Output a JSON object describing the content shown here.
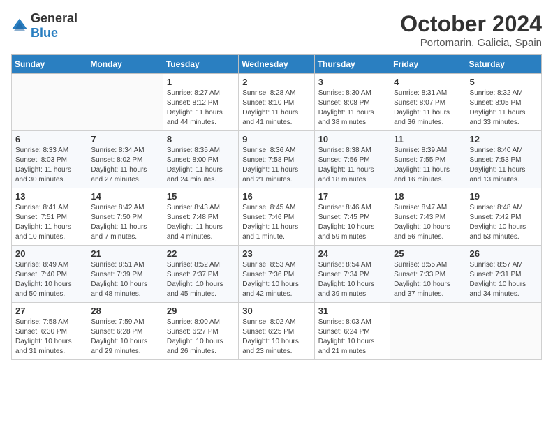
{
  "header": {
    "logo_general": "General",
    "logo_blue": "Blue",
    "month_year": "October 2024",
    "location": "Portomarin, Galicia, Spain"
  },
  "days_of_week": [
    "Sunday",
    "Monday",
    "Tuesday",
    "Wednesday",
    "Thursday",
    "Friday",
    "Saturday"
  ],
  "weeks": [
    [
      {
        "day": null,
        "content": ""
      },
      {
        "day": null,
        "content": ""
      },
      {
        "day": "1",
        "content": "Sunrise: 8:27 AM\nSunset: 8:12 PM\nDaylight: 11 hours and 44 minutes."
      },
      {
        "day": "2",
        "content": "Sunrise: 8:28 AM\nSunset: 8:10 PM\nDaylight: 11 hours and 41 minutes."
      },
      {
        "day": "3",
        "content": "Sunrise: 8:30 AM\nSunset: 8:08 PM\nDaylight: 11 hours and 38 minutes."
      },
      {
        "day": "4",
        "content": "Sunrise: 8:31 AM\nSunset: 8:07 PM\nDaylight: 11 hours and 36 minutes."
      },
      {
        "day": "5",
        "content": "Sunrise: 8:32 AM\nSunset: 8:05 PM\nDaylight: 11 hours and 33 minutes."
      }
    ],
    [
      {
        "day": "6",
        "content": "Sunrise: 8:33 AM\nSunset: 8:03 PM\nDaylight: 11 hours and 30 minutes."
      },
      {
        "day": "7",
        "content": "Sunrise: 8:34 AM\nSunset: 8:02 PM\nDaylight: 11 hours and 27 minutes."
      },
      {
        "day": "8",
        "content": "Sunrise: 8:35 AM\nSunset: 8:00 PM\nDaylight: 11 hours and 24 minutes."
      },
      {
        "day": "9",
        "content": "Sunrise: 8:36 AM\nSunset: 7:58 PM\nDaylight: 11 hours and 21 minutes."
      },
      {
        "day": "10",
        "content": "Sunrise: 8:38 AM\nSunset: 7:56 PM\nDaylight: 11 hours and 18 minutes."
      },
      {
        "day": "11",
        "content": "Sunrise: 8:39 AM\nSunset: 7:55 PM\nDaylight: 11 hours and 16 minutes."
      },
      {
        "day": "12",
        "content": "Sunrise: 8:40 AM\nSunset: 7:53 PM\nDaylight: 11 hours and 13 minutes."
      }
    ],
    [
      {
        "day": "13",
        "content": "Sunrise: 8:41 AM\nSunset: 7:51 PM\nDaylight: 11 hours and 10 minutes."
      },
      {
        "day": "14",
        "content": "Sunrise: 8:42 AM\nSunset: 7:50 PM\nDaylight: 11 hours and 7 minutes."
      },
      {
        "day": "15",
        "content": "Sunrise: 8:43 AM\nSunset: 7:48 PM\nDaylight: 11 hours and 4 minutes."
      },
      {
        "day": "16",
        "content": "Sunrise: 8:45 AM\nSunset: 7:46 PM\nDaylight: 11 hours and 1 minute."
      },
      {
        "day": "17",
        "content": "Sunrise: 8:46 AM\nSunset: 7:45 PM\nDaylight: 10 hours and 59 minutes."
      },
      {
        "day": "18",
        "content": "Sunrise: 8:47 AM\nSunset: 7:43 PM\nDaylight: 10 hours and 56 minutes."
      },
      {
        "day": "19",
        "content": "Sunrise: 8:48 AM\nSunset: 7:42 PM\nDaylight: 10 hours and 53 minutes."
      }
    ],
    [
      {
        "day": "20",
        "content": "Sunrise: 8:49 AM\nSunset: 7:40 PM\nDaylight: 10 hours and 50 minutes."
      },
      {
        "day": "21",
        "content": "Sunrise: 8:51 AM\nSunset: 7:39 PM\nDaylight: 10 hours and 48 minutes."
      },
      {
        "day": "22",
        "content": "Sunrise: 8:52 AM\nSunset: 7:37 PM\nDaylight: 10 hours and 45 minutes."
      },
      {
        "day": "23",
        "content": "Sunrise: 8:53 AM\nSunset: 7:36 PM\nDaylight: 10 hours and 42 minutes."
      },
      {
        "day": "24",
        "content": "Sunrise: 8:54 AM\nSunset: 7:34 PM\nDaylight: 10 hours and 39 minutes."
      },
      {
        "day": "25",
        "content": "Sunrise: 8:55 AM\nSunset: 7:33 PM\nDaylight: 10 hours and 37 minutes."
      },
      {
        "day": "26",
        "content": "Sunrise: 8:57 AM\nSunset: 7:31 PM\nDaylight: 10 hours and 34 minutes."
      }
    ],
    [
      {
        "day": "27",
        "content": "Sunrise: 7:58 AM\nSunset: 6:30 PM\nDaylight: 10 hours and 31 minutes."
      },
      {
        "day": "28",
        "content": "Sunrise: 7:59 AM\nSunset: 6:28 PM\nDaylight: 10 hours and 29 minutes."
      },
      {
        "day": "29",
        "content": "Sunrise: 8:00 AM\nSunset: 6:27 PM\nDaylight: 10 hours and 26 minutes."
      },
      {
        "day": "30",
        "content": "Sunrise: 8:02 AM\nSunset: 6:25 PM\nDaylight: 10 hours and 23 minutes."
      },
      {
        "day": "31",
        "content": "Sunrise: 8:03 AM\nSunset: 6:24 PM\nDaylight: 10 hours and 21 minutes."
      },
      {
        "day": null,
        "content": ""
      },
      {
        "day": null,
        "content": ""
      }
    ]
  ]
}
